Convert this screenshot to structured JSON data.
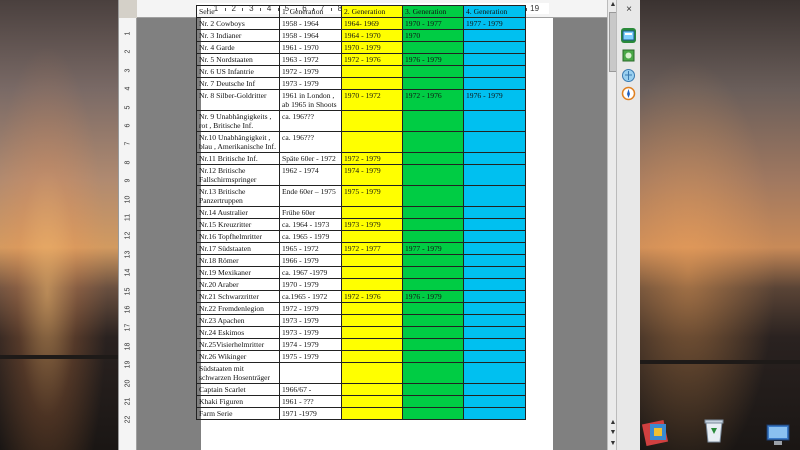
{
  "table": {
    "headers": [
      "Serie",
      "1. Generation",
      "2. Generation",
      "3. Generation",
      "4. Generation"
    ],
    "rows": [
      {
        "c": [
          "Nr. 2 Cowboys",
          "1958 - 1964",
          "1964- 1969",
          "1970 - 1977",
          "1977 - 1979"
        ],
        "h": "h1"
      },
      {
        "c": [
          "Nr. 3 Indianer",
          "1958 - 1964",
          "1964 - 1970",
          "1970",
          ""
        ],
        "h": "h1"
      },
      {
        "c": [
          "Nr. 4 Garde",
          "1961 - 1970",
          "1970 - 1979",
          "",
          ""
        ],
        "h": "h1"
      },
      {
        "c": [
          "Nr. 5 Nordstaaten",
          "1963 - 1972",
          "1972 - 1976",
          "1976 - 1979",
          ""
        ],
        "h": "h1"
      },
      {
        "c": [
          "Nr. 6 US Infantrie",
          "1972 - 1979",
          "",
          "",
          ""
        ],
        "h": "h1"
      },
      {
        "c": [
          "Nr. 7 Deutsche Inf",
          "1973 - 1979",
          "",
          "",
          ""
        ],
        "h": "h1"
      },
      {
        "c": [
          "Nr. 8 Silber-Goldritter",
          "1961 in London , ab 1965 in Shoots",
          "1970 - 1972",
          "1972 - 1976",
          "1976 - 1979"
        ],
        "h": "h2"
      },
      {
        "c": [
          "Nr. 9 Unabhängigkeits , rot , Britische Inf.",
          "ca. 196???",
          "",
          "",
          ""
        ],
        "h": "h2"
      },
      {
        "c": [
          "Nr.10 Unabhängigkeit , blau , Amerikanische Inf.",
          "ca. 196???",
          "",
          "",
          ""
        ],
        "h": "h2"
      },
      {
        "c": [
          "Nr.11 Britische Inf.",
          "Späte 60er - 1972",
          "1972 - 1979",
          "",
          ""
        ],
        "h": "h1"
      },
      {
        "c": [
          "Nr.12 Britische Fallschirmspringer",
          "1962 - 1974",
          "1974 - 1979",
          "",
          ""
        ],
        "h": "h2"
      },
      {
        "c": [
          "Nr.13 Britische Panzertruppen",
          "Ende 60er – 1975",
          "1975 - 1979",
          "",
          ""
        ],
        "h": "h2"
      },
      {
        "c": [
          "Nr.14 Australier",
          "Frühe 60er",
          "",
          "",
          ""
        ],
        "h": "h1"
      },
      {
        "c": [
          "Nr.15 Kreuzritter",
          "ca. 1964 - 1973",
          "1973 - 1979",
          "",
          ""
        ],
        "h": "h1"
      },
      {
        "c": [
          "Nr.16 Topfhelmritter",
          "ca. 1965 - 1979",
          "",
          "",
          ""
        ],
        "h": "h1"
      },
      {
        "c": [
          "Nr.17 Südstaaten",
          "1965 - 1972",
          "1972 - 1977",
          "1977 - 1979",
          ""
        ],
        "h": "h1"
      },
      {
        "c": [
          "Nr.18 Römer",
          "1966 - 1979",
          "",
          "",
          ""
        ],
        "h": "h1"
      },
      {
        "c": [
          "Nr.19 Mexikaner",
          "ca. 1967 -1979",
          "",
          "",
          ""
        ],
        "h": "h1"
      },
      {
        "c": [
          "Nr.20 Araber",
          "1970 - 1979",
          "",
          "",
          ""
        ],
        "h": "h1"
      },
      {
        "c": [
          "Nr.21 Schwarzritter",
          "ca.1965 - 1972",
          "1972 - 1976",
          "1976 - 1979",
          ""
        ],
        "h": "h1"
      },
      {
        "c": [
          "Nr.22 Fremdenlegion",
          "1972 - 1979",
          "",
          "",
          ""
        ],
        "h": "h1"
      },
      {
        "c": [
          "Nr.23 Apachen",
          "1973 - 1979",
          "",
          "",
          ""
        ],
        "h": "h1"
      },
      {
        "c": [
          "Nr.24 Eskimos",
          "1973 - 1979",
          "",
          "",
          ""
        ],
        "h": "h1"
      },
      {
        "c": [
          "Nr.25Visierhelmritter",
          "1974 - 1979",
          "",
          "",
          ""
        ],
        "h": "h1"
      },
      {
        "c": [
          "Nr.26 Wikinger",
          "1975 - 1979",
          "",
          "",
          ""
        ],
        "h": "h1"
      },
      {
        "c": [
          "Südstaaten mit schwarzen Hosenträger",
          "",
          "",
          "",
          ""
        ],
        "h": "h2"
      },
      {
        "c": [
          "Captain Scarlet",
          "1966/67 -",
          "",
          "",
          ""
        ],
        "h": "h1"
      },
      {
        "c": [
          "Khaki Figuren",
          "1961 - ???",
          "",
          "",
          ""
        ],
        "h": "h1"
      },
      {
        "c": [
          "Farm Serie",
          "1971 -1979",
          "",
          "",
          ""
        ],
        "h": "h1"
      }
    ]
  },
  "ruler": {
    "h_numbers": [
      "1",
      "2",
      "3",
      "4",
      "5",
      "6",
      "7",
      "8",
      "9",
      "10",
      "11",
      "12",
      "13",
      "14",
      "15",
      "16",
      "17",
      "18",
      "19"
    ],
    "v_numbers": [
      "1",
      "2",
      "3",
      "4",
      "5",
      "6",
      "7",
      "8",
      "9",
      "10",
      "11",
      "12",
      "13",
      "14",
      "15",
      "16",
      "17",
      "18",
      "19",
      "20",
      "21",
      "22"
    ]
  },
  "colors": {
    "gen2": "#ffff00",
    "gen3": "#00cc44",
    "gen4": "#00c0f0"
  },
  "sidebar": {
    "close_glyph": "×",
    "icons": [
      "properties-icon",
      "gallery-icon",
      "navigator-icon",
      "compass-icon"
    ]
  },
  "desktop": {
    "icons": [
      "puzzle-icon",
      "recycle-bin-icon",
      "monitor-icon"
    ]
  }
}
